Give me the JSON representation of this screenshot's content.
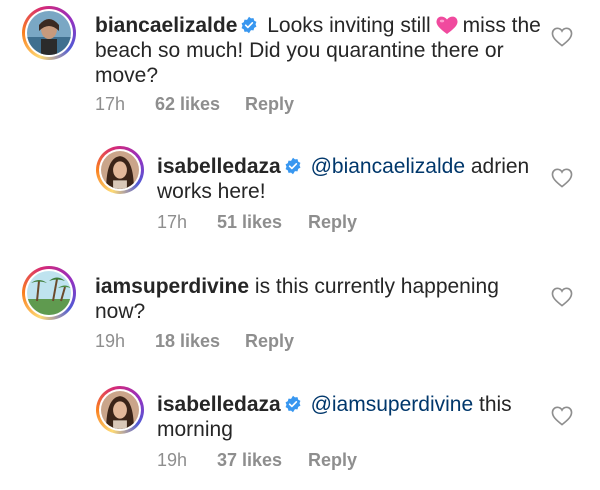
{
  "comments": [
    {
      "username": "biancaelizalde",
      "text_before_emoji": "Looks inviting still",
      "emoji": "pink-heart",
      "text_after_emoji": "miss the beach so much! Did you quarantine there or move?",
      "time": "17h",
      "likes": "62 likes",
      "reply": "Reply",
      "verified": true
    },
    {
      "username": "isabelledaza",
      "mention": "@biancaelizalde",
      "text": "adrien works here!",
      "time": "17h",
      "likes": "51 likes",
      "reply": "Reply",
      "verified": true
    },
    {
      "username": "iamsuperdivine",
      "text": "is this currently happening now?",
      "time": "19h",
      "likes": "18 likes",
      "reply": "Reply",
      "verified": false
    },
    {
      "username": "isabelledaza",
      "mention": "@iamsuperdivine",
      "text": "this morning",
      "time": "19h",
      "likes": "37 likes",
      "reply": "Reply",
      "verified": true
    }
  ],
  "colors": {
    "text": "#262626",
    "meta": "#8e8e8e",
    "mention": "#00376b",
    "verified": "#3897f0",
    "heart": "#f04a9e"
  },
  "icons": {
    "like": "heart-outline-icon",
    "verified": "verified-badge-icon"
  }
}
